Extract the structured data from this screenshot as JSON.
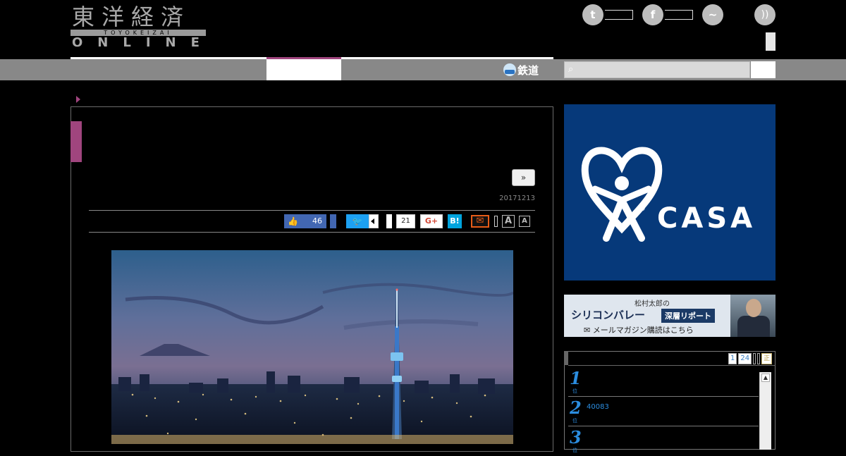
{
  "header": {
    "logo_kanji": "東洋経済",
    "logo_romaji": "TOYOKEIZAI",
    "logo_online": "ONLINE",
    "social": [
      {
        "name": "twitter",
        "glyph": "t"
      },
      {
        "name": "facebook",
        "glyph": "f"
      },
      {
        "name": "messenger",
        "glyph": "~"
      }
    ],
    "rss_glyph": "))"
  },
  "nav": {
    "rail_label": "鉄道",
    "search_icon": "⌕"
  },
  "article": {
    "next_label": "»",
    "date": "20171213",
    "share": {
      "like_glyph": "👍",
      "like_count": "46",
      "tweet_glyph": "🐦",
      "pocket_count": "21",
      "gplus_label": "G+",
      "hatena_label": "B!",
      "mail_glyph": "✉",
      "font_large": "A",
      "font_small": "A"
    },
    "photo_icon": "tokyo-skytree-night-photo"
  },
  "sidebar": {
    "ad1": {
      "brand": "CASA",
      "reg": "®"
    },
    "ad2": {
      "line1": "松村太郎の",
      "line2": "シリコンバレー",
      "tag": "深層リポート",
      "line3": "✉ メールマガジン購読はこちら"
    },
    "ranking": {
      "pager": [
        "1",
        "24"
      ],
      "pager_last": "正",
      "items": [
        {
          "num": "1",
          "suf": "位",
          "text": ""
        },
        {
          "num": "2",
          "suf": "位",
          "text": "40083"
        },
        {
          "num": "3",
          "suf": "位",
          "text": ""
        }
      ]
    }
  },
  "colors": {
    "accent": "#a0457e",
    "nav_gray": "#888888",
    "casa_blue": "#06397a",
    "rank_blue": "#2b8de0"
  }
}
